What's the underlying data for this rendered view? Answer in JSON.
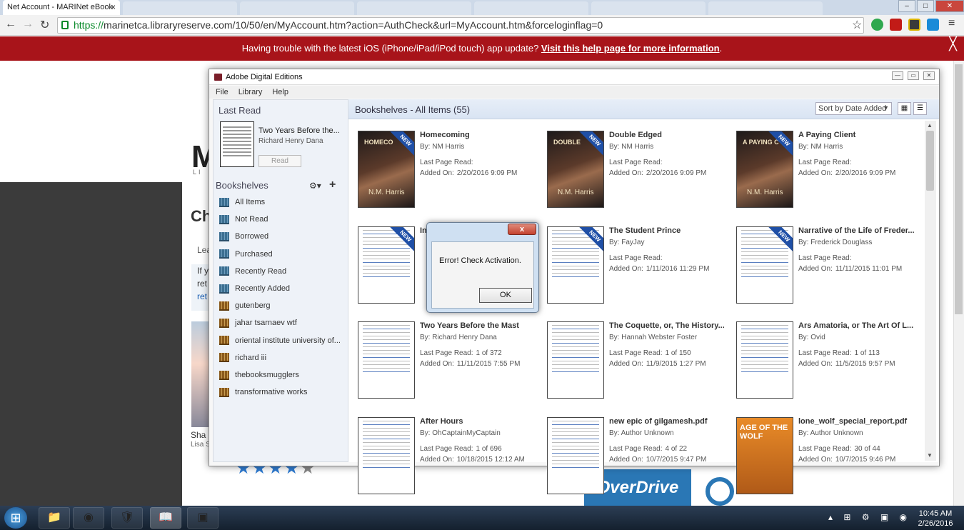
{
  "browser": {
    "tab_title": "Net Account - MARINet eBook",
    "tab_close": "×",
    "url_scheme": "https://",
    "url_rest": "marinetca.libraryreserve.com/10/50/en/MyAccount.htm?action=AuthCheck&url=MyAccount.htm&forceloginflag=0",
    "window_buttons": {
      "minimize": "–",
      "maximize": "□",
      "close": "✕"
    }
  },
  "banner": {
    "text": "Having trouble with the latest iOS (iPhone/iPad/iPod touch) app update? ",
    "link": "Visit this help page for more information",
    "suffix": ".",
    "close": "╳"
  },
  "page": {
    "logo": "M",
    "logo_sub": "LI",
    "heading": "Ch",
    "lea": "Lea",
    "box_lines": [
      "If y",
      "ret",
      "ret"
    ],
    "sha": "Sha",
    "lisa": "Lisa S",
    "stars_on": "★★★★",
    "stars_off": "★",
    "overdrive": "OverDrive"
  },
  "ade": {
    "title": "Adobe Digital Editions",
    "menu": [
      "File",
      "Library",
      "Help"
    ],
    "last_read": {
      "heading": "Last Read",
      "title": "Two Years Before the...",
      "author": "Richard Henry Dana",
      "read_button": "Read"
    },
    "bookshelves_heading": "Bookshelves",
    "shelves": [
      {
        "label": "All Items",
        "kind": "system"
      },
      {
        "label": "Not Read",
        "kind": "system"
      },
      {
        "label": "Borrowed",
        "kind": "system"
      },
      {
        "label": "Purchased",
        "kind": "system"
      },
      {
        "label": "Recently Read",
        "kind": "system"
      },
      {
        "label": "Recently Added",
        "kind": "system"
      },
      {
        "label": "gutenberg",
        "kind": "user"
      },
      {
        "label": "jahar tsarnaev wtf",
        "kind": "user"
      },
      {
        "label": "oriental institute university of...",
        "kind": "user"
      },
      {
        "label": "richard iii",
        "kind": "user"
      },
      {
        "label": "thebooksmugglers",
        "kind": "user"
      },
      {
        "label": "transformative works",
        "kind": "user"
      }
    ],
    "main_title": "Bookshelves - All Items (55)",
    "sort_label": "Sort by Date Added",
    "lpr_label": "Last Page Read:",
    "added_label": "Added On:",
    "new_label": "NEW",
    "books": [
      {
        "title": "Homecoming",
        "author": "By:  NM Harris",
        "lpr": "",
        "added": "2/20/2016 9:09 PM",
        "cover": "photo",
        "new": true,
        "cover_title": "HOMECO",
        "cover_author": "N.M. Harris"
      },
      {
        "title": "Double Edged",
        "author": "By:  NM Harris",
        "lpr": "",
        "added": "2/20/2016 9:09 PM",
        "cover": "photo",
        "new": true,
        "cover_title": "DOUBLE",
        "cover_author": "N.M. Harris"
      },
      {
        "title": "A Paying Client",
        "author": "By:  NM Harris",
        "lpr": "",
        "added": "2/20/2016 9:09 PM",
        "cover": "photo",
        "new": true,
        "cover_title": "A PAYING C",
        "cover_author": "N.M. Harris"
      },
      {
        "title": "Inconvenient Moments",
        "author": "",
        "lpr": "",
        "added": "",
        "cover": "text",
        "new": true
      },
      {
        "title": "The Student Prince",
        "author": "By:  FayJay",
        "lpr": "",
        "added": "1/11/2016 11:29 PM",
        "cover": "text",
        "new": true
      },
      {
        "title": "Narrative of the Life of Freder...",
        "author": "By:  Frederick Douglass",
        "lpr": "",
        "added": "11/11/2015 11:01 PM",
        "cover": "text",
        "new": true
      },
      {
        "title": "Two Years Before the Mast",
        "author": "By:  Richard Henry Dana",
        "lpr": "1 of 372",
        "added": "11/11/2015 7:55 PM",
        "cover": "text",
        "new": false
      },
      {
        "title": "The Coquette, or, The History...",
        "author": "By:  Hannah Webster Foster",
        "lpr": "1 of 150",
        "added": "11/9/2015 1:27 PM",
        "cover": "text",
        "new": false
      },
      {
        "title": "Ars Amatoria, or The Art Of L...",
        "author": "By:  Ovid",
        "lpr": "1 of 113",
        "added": "11/5/2015 9:57 PM",
        "cover": "text",
        "new": false
      },
      {
        "title": "After Hours",
        "author": "By:  OhCaptainMyCaptain",
        "lpr": "1 of 696",
        "added": "10/18/2015 12:12 AM",
        "cover": "text",
        "new": false
      },
      {
        "title": "new epic of gilgamesh.pdf",
        "author": "By:  Author Unknown",
        "lpr": "4 of 22",
        "added": "10/7/2015 9:47 PM",
        "cover": "text",
        "new": false
      },
      {
        "title": "lone_wolf_special_report.pdf",
        "author": "By:  Author Unknown",
        "lpr": "30 of 44",
        "added": "10/7/2015 9:46 PM",
        "cover": "orange",
        "new": false,
        "cover_title": "AGE OF THE WOLF"
      }
    ],
    "error_dialog": {
      "close": "x",
      "message": "Error! Check Activation.",
      "ok": "OK"
    }
  },
  "taskbar": {
    "time": "10:45 AM",
    "date": "2/26/2016",
    "tray": "▴ ⊞ ⚙ ▣ ◉"
  }
}
